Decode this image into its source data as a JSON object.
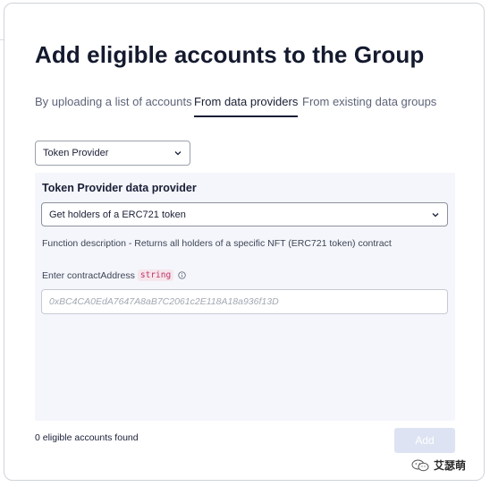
{
  "modal": {
    "title": "Add eligible accounts to the Group",
    "tabs": [
      {
        "label": "By uploading a list of accounts",
        "active": false
      },
      {
        "label": "From data providers",
        "active": true
      },
      {
        "label": "From existing data groups",
        "active": false
      }
    ],
    "provider_select": {
      "value": "Token Provider",
      "icon": "chevron-down-icon"
    },
    "panel": {
      "title": "Token Provider data provider",
      "function_select": {
        "value": "Get holders of a ERC721 token",
        "icon": "chevron-down-icon"
      },
      "function_description": "Function description - Returns all holders of a specific NFT (ERC721 token) contract",
      "field": {
        "label": "Enter contractAddress",
        "type_badge": "string",
        "info_icon": "info-icon",
        "value": "",
        "placeholder": "0xBC4CA0EdA7647A8aB7C2061c2E118A18a936f13D"
      }
    },
    "found_text": "0 eligible accounts found",
    "add_button": {
      "label": "Add",
      "enabled": false
    }
  },
  "watermark": {
    "text": "艾瑟萌",
    "icon": "wechat-icon"
  },
  "colors": {
    "text": "#1a1f36",
    "panel_bg": "#f4f6fb",
    "badge_text": "#c0326a",
    "badge_bg": "#f6e6ec",
    "button_disabled_bg": "#dde3f2"
  }
}
